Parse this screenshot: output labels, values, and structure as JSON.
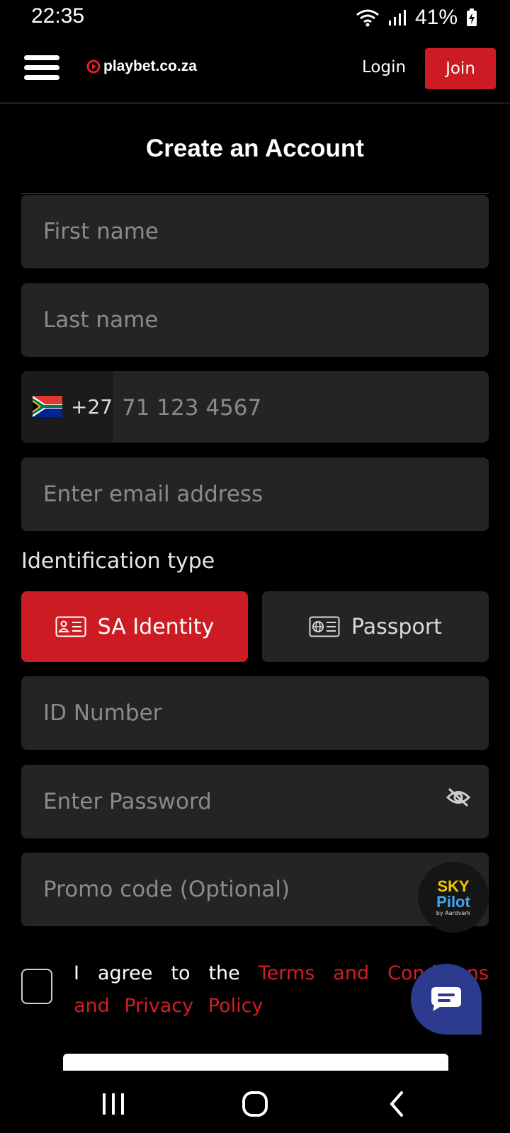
{
  "status_bar": {
    "time": "22:35",
    "battery": "41%",
    "icons": [
      "wifi-icon",
      "signal-icon",
      "battery-charging-icon"
    ]
  },
  "header": {
    "logo_text": "playbet.co.za",
    "login_label": "Login",
    "join_label": "Join",
    "accent_color": "#cc1b22"
  },
  "page": {
    "title": "Create an Account"
  },
  "form": {
    "first_name_placeholder": "First name",
    "last_name_placeholder": "Last name",
    "phone": {
      "country_flag": "south-africa-flag-icon",
      "dial_code": "+27",
      "placeholder": "71 123 4567"
    },
    "email_placeholder": "Enter email address",
    "identification_label": "Identification type",
    "id_options": [
      {
        "label": "SA Identity",
        "icon": "id-card-icon",
        "selected": true
      },
      {
        "label": "Passport",
        "icon": "passport-icon",
        "selected": false
      }
    ],
    "id_number_placeholder": "ID Number",
    "password_placeholder": "Enter Password",
    "promo_placeholder": "Promo code (Optional)",
    "agree_prefix": "I agree to the",
    "terms_link": "Terms and Conditions",
    "and_text": "and",
    "privacy_link": "Privacy Policy",
    "terms_checked": false
  },
  "promo_badge": {
    "title": "SKY",
    "subtitle": "Pilot",
    "by": "by Aardvark"
  },
  "nav_bar": {
    "buttons": [
      "recent-apps-icon",
      "home-icon",
      "back-icon"
    ]
  }
}
